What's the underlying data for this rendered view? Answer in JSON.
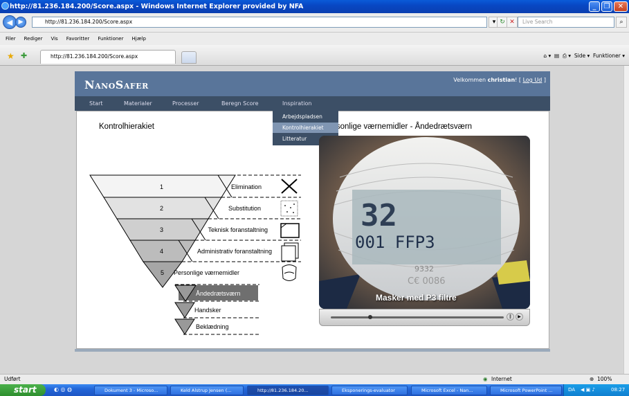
{
  "window": {
    "title": "http://81.236.184.200/Score.aspx - Windows Internet Explorer provided by NFA",
    "min": "_",
    "max": "❐",
    "close": "✕"
  },
  "address": {
    "url": "http://81.236.184.200/Score.aspx",
    "search_placeholder": "Live Search"
  },
  "menubar": [
    "Filer",
    "Rediger",
    "Vis",
    "Favoritter",
    "Funktioner",
    "Hjælp"
  ],
  "tab": {
    "label": "http://81.236.184.200/Score.aspx"
  },
  "commandbar": {
    "side": "Side",
    "funktioner": "Funktioner"
  },
  "site": {
    "logo": "NanoSafer",
    "welcome_prefix": "Velkommen ",
    "user": "christian",
    "welcome_suffix": "! [ ",
    "logout": "Log Ud",
    "welcome_end": " ]",
    "nav": [
      "Start",
      "Materialer",
      "Processer",
      "Beregn Score",
      "Inspiration"
    ],
    "dropdown": [
      "Arbejdspladsen",
      "Kontrolhierakiet",
      "Litteratur"
    ],
    "dropdown_selected": 1
  },
  "content": {
    "left_heading": "Kontrolhierakiet",
    "right_heading": "rsonlige værnemidler  - Åndedrætsværn",
    "levels": [
      {
        "num": "1",
        "label": "Elimination"
      },
      {
        "num": "2",
        "label": "Substitution"
      },
      {
        "num": "3",
        "label": "Teknisk foranstaltning"
      },
      {
        "num": "4",
        "label": "Administrativ foranstaltning"
      },
      {
        "num": "5",
        "label": "Personlige værnemidler"
      }
    ],
    "sublevels": [
      "Åndedrætsværn",
      "Handsker",
      "Beklædning"
    ],
    "photo_caption": "Masker med P3 filtre",
    "mask_text": "32",
    "mask_code": "001 FFP3",
    "mask_small": "9332",
    "mask_ce": "C€ 0086"
  },
  "status": {
    "text": "Udført",
    "zone": "Internet",
    "zoom": "100%"
  },
  "taskbar": {
    "start": "start",
    "tasks": [
      "Dokument 3 - Microso...",
      "Keld Alstrup Jensen (...",
      "http://81.236.184.20...",
      "Eksponerings-evaluator",
      "Microsoft Excel - Nan...",
      "Microsoft PowerPoint ..."
    ],
    "active_task": 2,
    "lang": "DA",
    "clock": "08:27"
  }
}
